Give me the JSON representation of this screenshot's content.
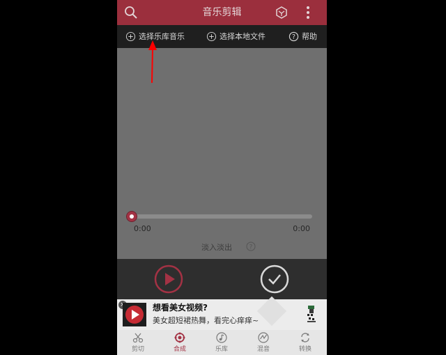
{
  "app": {
    "title": "音乐剪辑"
  },
  "toolbar": {
    "library_label": "选择乐库音乐",
    "local_label": "选择本地文件",
    "help_label": "帮助"
  },
  "player": {
    "time_start": "0:00",
    "time_end": "0:00",
    "fade_label": "淡入淡出",
    "progress": 0
  },
  "ad": {
    "title": "想看美女视频?",
    "description": "美女超短裙热舞，看完心痒痒~"
  },
  "bottom_nav": [
    {
      "label": "剪切",
      "icon": "scissors-icon",
      "active": false
    },
    {
      "label": "合成",
      "icon": "merge-icon",
      "active": true
    },
    {
      "label": "乐库",
      "icon": "music-note-icon",
      "active": false
    },
    {
      "label": "混音",
      "icon": "mix-icon",
      "active": false
    },
    {
      "label": "转换",
      "icon": "convert-icon",
      "active": false
    }
  ],
  "colors": {
    "accent": "#9b2f3d",
    "active_nav": "#a33244",
    "annotation_arrow": "#ff0000"
  }
}
